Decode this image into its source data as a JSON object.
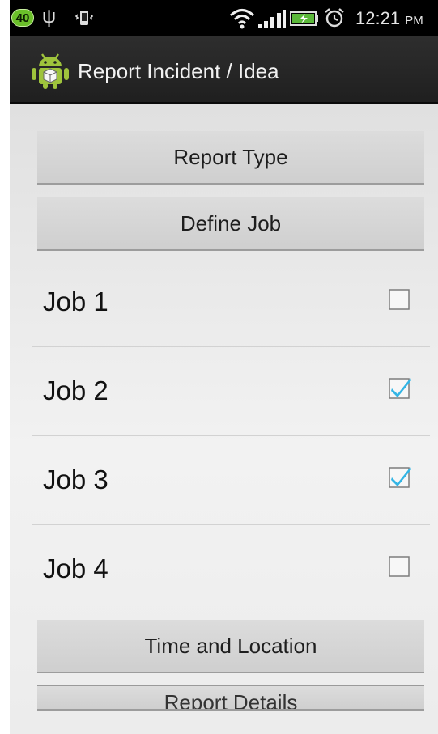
{
  "status_bar": {
    "badge": "40",
    "time": "12:21",
    "ampm": "PM",
    "icons": [
      "usb-icon",
      "vibrate-icon",
      "wifi-icon",
      "signal-icon",
      "battery-charging-icon",
      "alarm-icon"
    ]
  },
  "action_bar": {
    "title": "Report Incident / Idea",
    "icon": "android-app-icon"
  },
  "buttons": {
    "report_type": "Report Type",
    "define_job": "Define Job",
    "time_location": "Time and Location",
    "report_details": "Report Details"
  },
  "jobs": [
    {
      "label": "Job 1",
      "checked": false
    },
    {
      "label": "Job 2",
      "checked": true
    },
    {
      "label": "Job 3",
      "checked": true
    },
    {
      "label": "Job 4",
      "checked": false
    }
  ],
  "colors": {
    "check_accent": "#33b5e5",
    "badge_green": "#6bbf2a",
    "android_green": "#9fc43c"
  }
}
